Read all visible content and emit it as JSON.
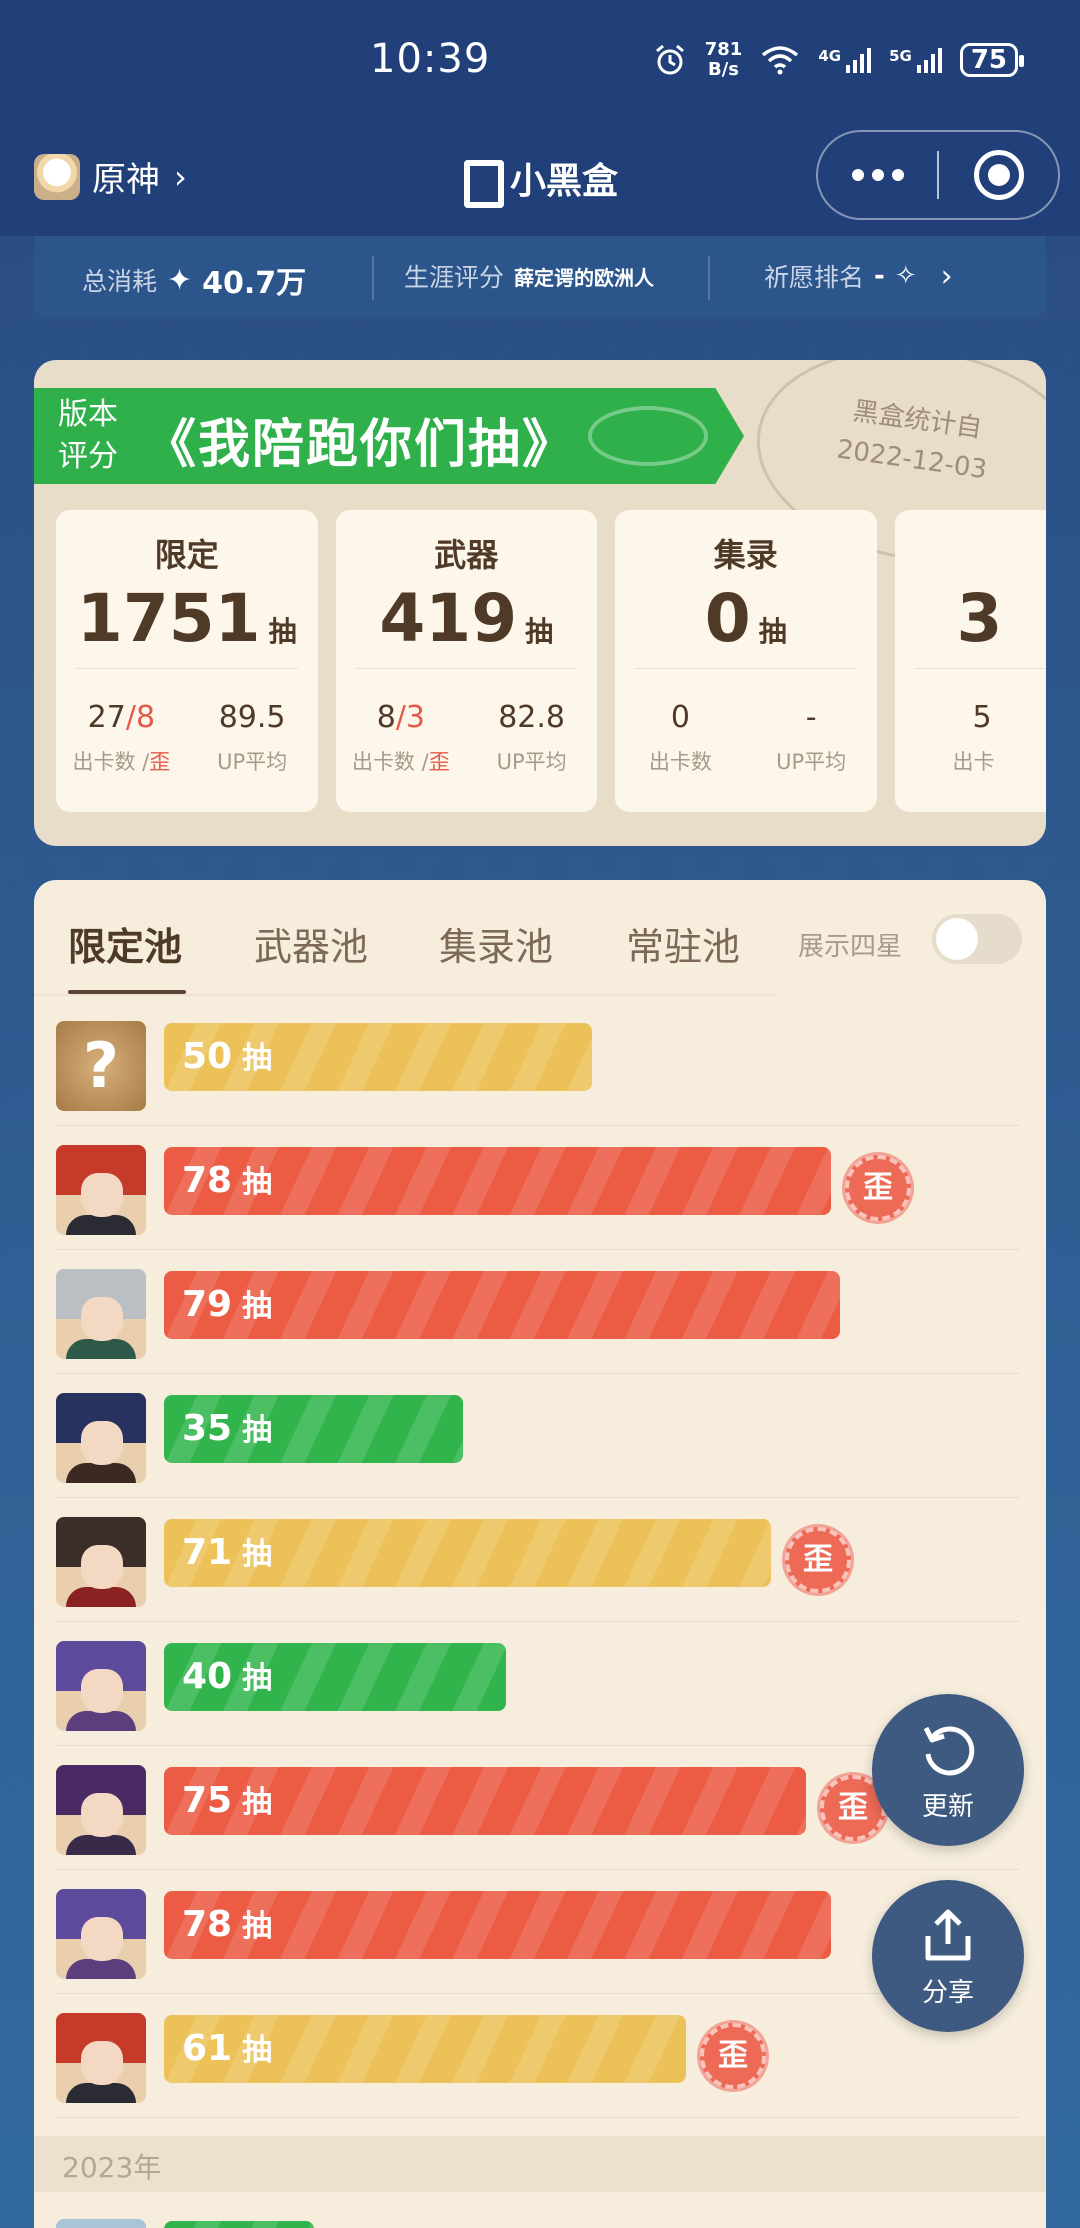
{
  "status_bar": {
    "time": "10:39",
    "speed_value": "781",
    "speed_unit": "B/s",
    "sig1_label": "4G",
    "sig2_label": "5G",
    "battery": "75"
  },
  "nav": {
    "app_name": "原神",
    "title": "小黑盒"
  },
  "summary": {
    "total_label": "总消耗",
    "total_value": "40.7万",
    "career_label": "生涯评分",
    "career_value": "薛定谔的欧洲人",
    "rank_label": "祈愿排名",
    "rank_value": "-"
  },
  "version": {
    "tag": "版本评分",
    "title": "《我陪跑你们抽》",
    "stamp_line1": "黑盒统计自",
    "stamp_line2": "2022-12-03",
    "stats": [
      {
        "name": "限定",
        "count": "1751",
        "unit": "抽",
        "a_main": "27",
        "a_red": "8",
        "b_value": "89.5",
        "a_label": "出卡数 /",
        "a_label_red": "歪",
        "b_label": "UP平均"
      },
      {
        "name": "武器",
        "count": "419",
        "unit": "抽",
        "a_main": "8",
        "a_red": "3",
        "b_value": "82.8",
        "a_label": "出卡数 /",
        "a_label_red": "歪",
        "b_label": "UP平均"
      },
      {
        "name": "集录",
        "count": "0",
        "unit": "抽",
        "a_main": "0",
        "a_red": "",
        "b_value": "-",
        "a_label": "出卡数",
        "a_label_red": "",
        "b_label": "UP平均"
      },
      {
        "name": "",
        "count": "3",
        "unit": "",
        "a_main": "5",
        "a_red": "",
        "b_value": "",
        "a_label": "出卡",
        "a_label_red": "",
        "b_label": ""
      }
    ]
  },
  "pools": {
    "tabs": [
      "限定池",
      "武器池",
      "集录池",
      "常驻池"
    ],
    "show_four_star_label": "展示四星",
    "show_four_star": false,
    "unit": "抽",
    "wai_label": "歪",
    "pulls": [
      {
        "value": 50,
        "color": "yellow",
        "wai": false,
        "avatar": "unknown"
      },
      {
        "value": 78,
        "color": "red",
        "wai": true,
        "avatar": "red-hair"
      },
      {
        "value": 79,
        "color": "red",
        "wai": false,
        "avatar": "silver-hair"
      },
      {
        "value": 35,
        "color": "green",
        "wai": false,
        "avatar": "dark-hair-glasses"
      },
      {
        "value": 71,
        "color": "yellow",
        "wai": true,
        "avatar": "dark-hair-ears"
      },
      {
        "value": 40,
        "color": "green",
        "wai": false,
        "avatar": "purple-hair"
      },
      {
        "value": 75,
        "color": "red",
        "wai": true,
        "avatar": "witch-hat"
      },
      {
        "value": 78,
        "color": "red",
        "wai": false,
        "avatar": "purple-hair"
      },
      {
        "value": 61,
        "color": "yellow",
        "wai": true,
        "avatar": "red-hair"
      }
    ],
    "year_label": "2023年"
  },
  "fabs": {
    "refresh": "更新",
    "share": "分享"
  }
}
